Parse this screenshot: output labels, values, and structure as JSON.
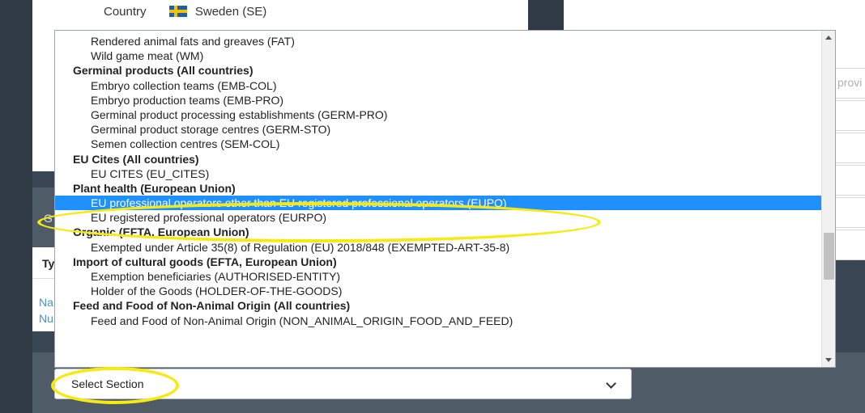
{
  "background": {
    "country_label": "Country",
    "country_value": "Sweden (SE)",
    "right_hint": "provi",
    "mid_text": "G",
    "info_type": "Ty",
    "info_na": "Na",
    "info_nu": "Nu"
  },
  "dropdown": {
    "items": [
      {
        "type": "option",
        "label": "Rendered animal fats and greaves (FAT)"
      },
      {
        "type": "option",
        "label": "Wild game meat (WM)"
      },
      {
        "type": "group",
        "label": "Germinal products (All countries)"
      },
      {
        "type": "option",
        "label": "Embryo collection teams (EMB-COL)"
      },
      {
        "type": "option",
        "label": "Embryo production teams (EMB-PRO)"
      },
      {
        "type": "option",
        "label": "Germinal product processing establishments (GERM-PRO)"
      },
      {
        "type": "option",
        "label": "Germinal product storage centres (GERM-STO)"
      },
      {
        "type": "option",
        "label": "Semen collection centres (SEM-COL)"
      },
      {
        "type": "group",
        "label": "EU Cites (All countries)"
      },
      {
        "type": "option",
        "label": "EU CITES (EU_CITES)"
      },
      {
        "type": "group",
        "label": "Plant health (European Union)"
      },
      {
        "type": "option",
        "label": "EU professional operators other than EU registered professional operators (EUPO)",
        "selected": true
      },
      {
        "type": "option",
        "label": "EU registered professional operators (EURPO)"
      },
      {
        "type": "group",
        "label": "Organic (EFTA, European Union)"
      },
      {
        "type": "option",
        "label": "Exempted under Article 35(8) of Regulation (EU) 2018/848 (EXEMPTED-ART-35-8)"
      },
      {
        "type": "group",
        "label": "Import of cultural goods (EFTA, European Union)"
      },
      {
        "type": "option",
        "label": "Exemption beneficiaries (AUTHORISED-ENTITY)"
      },
      {
        "type": "option",
        "label": "Holder of the Goods (HOLDER-OF-THE-GOODS)"
      },
      {
        "type": "group",
        "label": "Feed and Food of Non-Animal Origin (All countries)"
      },
      {
        "type": "option",
        "label": "Feed and Food of Non-Animal Origin (NON_ANIMAL_ORIGIN_FOOD_AND_FEED)"
      }
    ],
    "scroll_position": 0.72
  },
  "select": {
    "value": "Select Section"
  },
  "colors": {
    "selection": "#1e90ff",
    "highlight": "#f7ea12",
    "page_dark": "#3a4654"
  }
}
